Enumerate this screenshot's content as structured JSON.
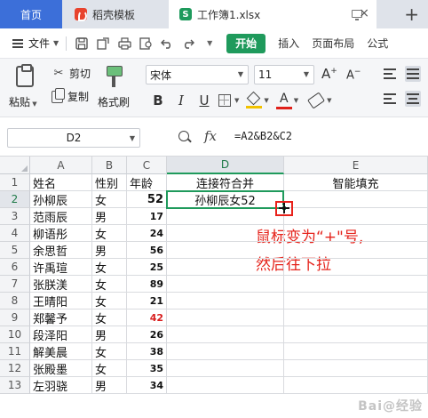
{
  "tabs": {
    "home": "首页",
    "template": "稻壳模板",
    "workbook": "工作簿1.xlsx",
    "workbook_badge": "S",
    "close": "×",
    "new_tab": "+"
  },
  "menu": {
    "file": "文件",
    "start": "开始",
    "insert": "插入",
    "page_layout": "页面布局",
    "formula": "公式"
  },
  "ribbon": {
    "paste": "粘贴",
    "cut": "剪切",
    "copy": "复制",
    "format_painter": "格式刷",
    "font_name": "宋体",
    "font_size": "11",
    "bold": "B",
    "italic": "I",
    "underline": "U",
    "grow": "A",
    "shrink": "A",
    "font_color_glyph": "A"
  },
  "formula_bar": {
    "cell_ref": "D2",
    "fx": "fx",
    "formula": "=A2&B2&C2"
  },
  "grid": {
    "columns": [
      "A",
      "B",
      "C",
      "D",
      "E"
    ],
    "headers": [
      "姓名",
      "性别",
      "年龄",
      "连接符合并",
      "智能填充"
    ],
    "rows": [
      {
        "n": "2",
        "name": "孙柳辰",
        "gender": "女",
        "age": "52",
        "concat": "孙柳辰女52"
      },
      {
        "n": "3",
        "name": "范雨辰",
        "gender": "男",
        "age": "17",
        "concat": ""
      },
      {
        "n": "4",
        "name": "柳语彤",
        "gender": "女",
        "age": "24",
        "concat": ""
      },
      {
        "n": "5",
        "name": "余思哲",
        "gender": "男",
        "age": "56",
        "concat": ""
      },
      {
        "n": "6",
        "name": "许禹瑄",
        "gender": "女",
        "age": "25",
        "concat": ""
      },
      {
        "n": "7",
        "name": "张朕渼",
        "gender": "女",
        "age": "89",
        "concat": ""
      },
      {
        "n": "8",
        "name": "王晴阳",
        "gender": "女",
        "age": "21",
        "concat": ""
      },
      {
        "n": "9",
        "name": "郑馨予",
        "gender": "女",
        "age": "42",
        "concat": ""
      },
      {
        "n": "10",
        "name": "段泽阳",
        "gender": "男",
        "age": "26",
        "concat": ""
      },
      {
        "n": "11",
        "name": "解美晨",
        "gender": "女",
        "age": "38",
        "concat": ""
      },
      {
        "n": "12",
        "name": "张殿墨",
        "gender": "女",
        "age": "35",
        "concat": ""
      },
      {
        "n": "13",
        "name": "左羽骁",
        "gender": "男",
        "age": "34",
        "concat": ""
      }
    ],
    "header_row_number": "1"
  },
  "annotation": {
    "line1": "鼠标变为“+\"号,",
    "line2": "然后往下拉"
  },
  "watermark": "Bai@经验",
  "colors": {
    "accent_green": "#1f9a5c",
    "home_tab_blue": "#3c6fd9",
    "annotation_red": "#e5231b"
  },
  "icons": [
    "menu-icon",
    "save-icon",
    "export-icon",
    "print-icon",
    "preview-icon",
    "undo-icon",
    "redo-icon",
    "paste-icon",
    "cut-icon",
    "copy-icon",
    "format-painter-icon",
    "border-icon",
    "fill-color-icon",
    "font-color-icon",
    "eraser-icon",
    "align-icon",
    "zoom-icon"
  ]
}
